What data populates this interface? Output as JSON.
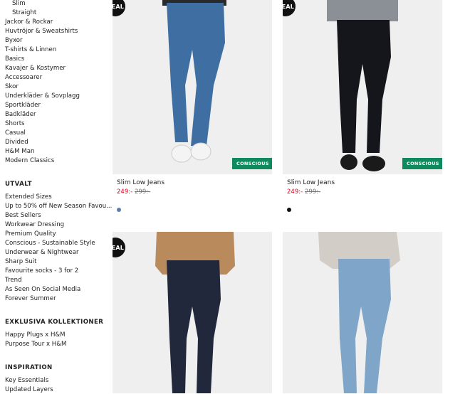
{
  "sidebar": {
    "categories": [
      {
        "label": "Slim",
        "indent": true
      },
      {
        "label": "Straight",
        "indent": true
      },
      {
        "label": "Jackor & Rockar"
      },
      {
        "label": "Huvtröjor & Sweatshirts"
      },
      {
        "label": "Byxor"
      },
      {
        "label": "T-shirts & Linnen"
      },
      {
        "label": "Basics"
      },
      {
        "label": "Kavajer & Kostymer"
      },
      {
        "label": "Accessoarer"
      },
      {
        "label": "Skor"
      },
      {
        "label": "Underkläder & Sovplagg"
      },
      {
        "label": "Sportkläder"
      },
      {
        "label": "Badkläder"
      },
      {
        "label": "Shorts"
      },
      {
        "label": "Casual"
      },
      {
        "label": "Divided"
      },
      {
        "label": "H&M Man"
      },
      {
        "label": "Modern Classics"
      }
    ],
    "utvalt_heading": "UTVALT",
    "utvalt": [
      "Extended Sizes",
      "Up to 50% off New Season Favou...",
      "Best Sellers",
      "Workwear Dressing",
      "Premium Quality",
      "Conscious - Sustainable Style",
      "Underwear & Nightwear",
      "Sharp Suit",
      "Favourite socks - 3 for 2",
      "Trend",
      "As Seen On Social Media",
      "Forever Summer"
    ],
    "exklusiva_heading": "EXKLUSIVA KOLLEKTIONER",
    "exklusiva": [
      "Happy Plugs x H&M",
      "Purpose Tour x H&M"
    ],
    "inspiration_heading": "INSPIRATION",
    "inspiration": [
      "Key Essentials",
      "Updated Layers"
    ]
  },
  "products": [
    {
      "name": "Slim Low Jeans",
      "price": "249:-",
      "old_price": "299:-",
      "deal_badge": "DEAL",
      "conscious_badge": "CONSCIOUS",
      "jean_color": "#3f6ea3",
      "swatch_color": "#5b7fb0"
    },
    {
      "name": "Slim Low Jeans",
      "price": "249:-",
      "old_price": "299:-",
      "deal_badge": "DEAL",
      "conscious_badge": "CONSCIOUS",
      "jean_color": "#15161b",
      "swatch_color": "#111111"
    },
    {
      "deal_badge": "DEAL",
      "jean_color": "#22283c",
      "top_color": "#b98a5c"
    },
    {
      "jean_color": "#7fa6c9",
      "top_color": "#d2cdc6"
    }
  ]
}
